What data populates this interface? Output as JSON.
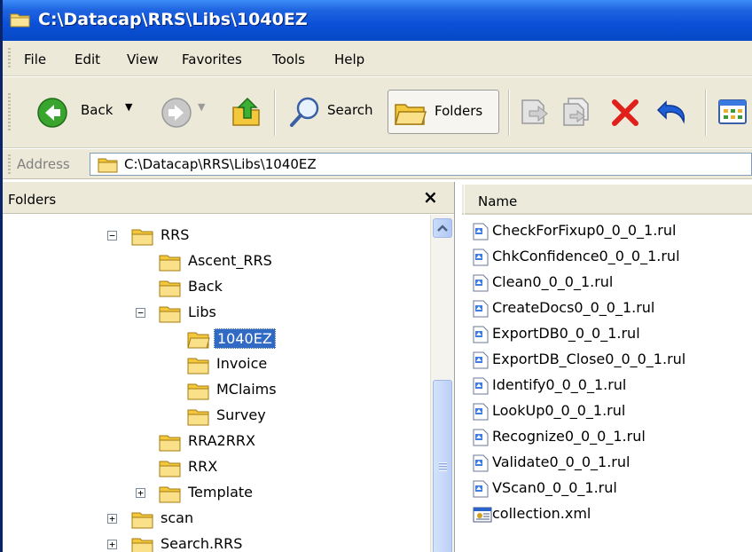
{
  "window": {
    "title": "C:\\Datacap\\RRS\\Libs\\1040EZ"
  },
  "menu": [
    "File",
    "Edit",
    "View",
    "Favorites",
    "Tools",
    "Help"
  ],
  "toolbar": {
    "back_label": "Back",
    "search_label": "Search",
    "folders_label": "Folders"
  },
  "address": {
    "label": "Address",
    "value": "C:\\Datacap\\RRS\\Libs\\1040EZ"
  },
  "folders_pane": {
    "title": "Folders",
    "close": "×",
    "tree": [
      {
        "label": "RRS",
        "depth": 0,
        "expander": "minus"
      },
      {
        "label": "Ascent_RRS",
        "depth": 1,
        "expander": "none"
      },
      {
        "label": "Back",
        "depth": 1,
        "expander": "none"
      },
      {
        "label": "Libs",
        "depth": 1,
        "expander": "minus"
      },
      {
        "label": "1040EZ",
        "depth": 2,
        "expander": "none",
        "selected": true,
        "open": true
      },
      {
        "label": "Invoice",
        "depth": 2,
        "expander": "none"
      },
      {
        "label": "MClaims",
        "depth": 2,
        "expander": "none"
      },
      {
        "label": "Survey",
        "depth": 2,
        "expander": "none"
      },
      {
        "label": "RRA2RRX",
        "depth": 1,
        "expander": "none"
      },
      {
        "label": "RRX",
        "depth": 1,
        "expander": "none"
      },
      {
        "label": "Template",
        "depth": 1,
        "expander": "plus"
      },
      {
        "label": "scan",
        "depth": -1,
        "expander": "plus"
      },
      {
        "label": "Search.RRS",
        "depth": -1,
        "expander": "plus"
      }
    ]
  },
  "file_list": {
    "column_name": "Name",
    "files": [
      {
        "name": "CheckForFixup0_0_0_1.rul",
        "icon": "rul-file-icon"
      },
      {
        "name": "ChkConfidence0_0_0_1.rul",
        "icon": "rul-file-icon"
      },
      {
        "name": "Clean0_0_0_1.rul",
        "icon": "rul-file-icon"
      },
      {
        "name": "CreateDocs0_0_0_1.rul",
        "icon": "rul-file-icon"
      },
      {
        "name": "ExportDB0_0_0_1.rul",
        "icon": "rul-file-icon"
      },
      {
        "name": "ExportDB_Close0_0_0_1.rul",
        "icon": "rul-file-icon"
      },
      {
        "name": "Identify0_0_0_1.rul",
        "icon": "rul-file-icon"
      },
      {
        "name": "LookUp0_0_0_1.rul",
        "icon": "rul-file-icon"
      },
      {
        "name": "Recognize0_0_0_1.rul",
        "icon": "rul-file-icon"
      },
      {
        "name": "Validate0_0_0_1.rul",
        "icon": "rul-file-icon"
      },
      {
        "name": "VScan0_0_0_1.rul",
        "icon": "rul-file-icon"
      },
      {
        "name": "collection.xml",
        "icon": "xml-file-icon"
      }
    ]
  },
  "colors": {
    "titlebar": "#0a50d8",
    "chrome": "#ece9d8",
    "selection": "#316ac5",
    "delete_red": "#e0201a"
  }
}
